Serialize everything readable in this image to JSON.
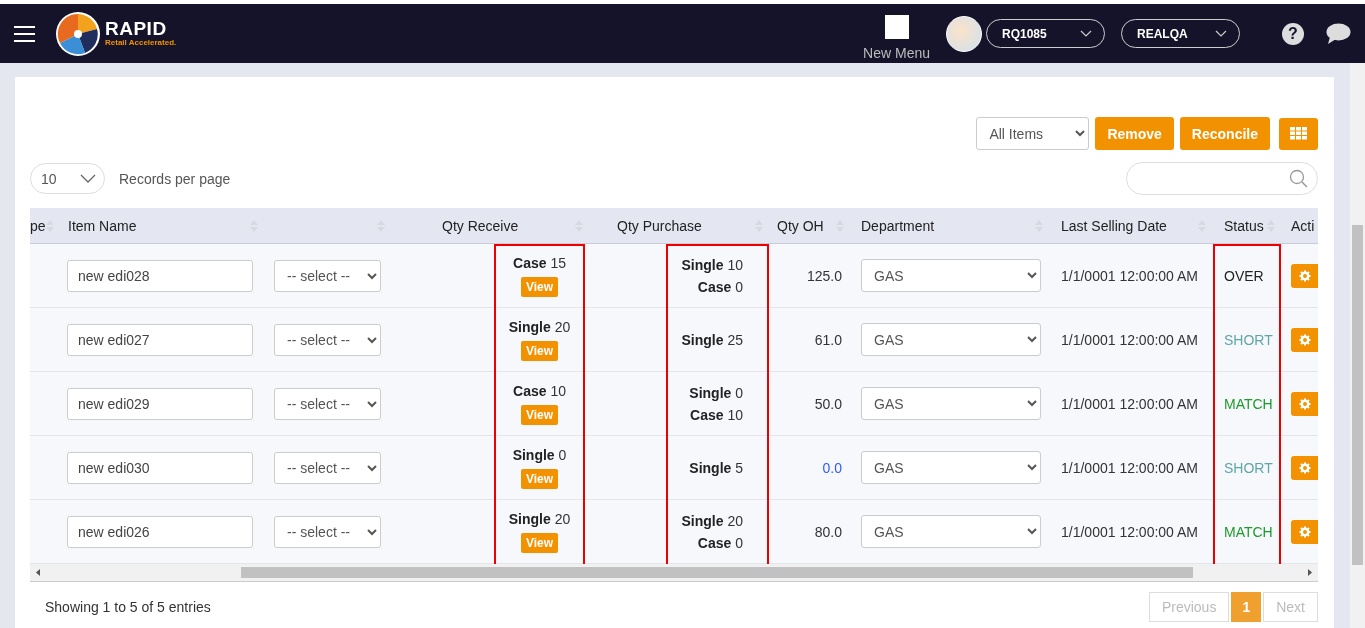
{
  "topbar": {
    "logo": {
      "name": "RAPID",
      "tagline": "Retail Accelerated."
    },
    "new_menu": "New Menu",
    "store_select": "RQ1085",
    "env_select": "REALQA",
    "help": "?"
  },
  "toolbar": {
    "filter": "All Items",
    "buttons": [
      "Remove",
      "Reconcile"
    ],
    "page_size": "10",
    "page_size_label": "Records per page"
  },
  "table": {
    "columns": [
      {
        "label": "pe",
        "kind": "clipped",
        "highlighted": false
      },
      {
        "label": "Item Name",
        "kind": "item_input",
        "highlighted": false
      },
      {
        "kind": "mapping_select",
        "highlighted": false
      },
      {
        "label": "Qty Receive",
        "kind": "qty_receive",
        "highlighted": true
      },
      {
        "label": "Qty Purchase",
        "kind": "qty_purchase",
        "highlighted": true
      },
      {
        "label": "Qty OH",
        "kind": "qty_oh",
        "highlighted": false
      },
      {
        "label": "Department",
        "kind": "department",
        "highlighted": false
      },
      {
        "label": "Last Selling Date",
        "kind": "date",
        "highlighted": false
      },
      {
        "label": "Status",
        "kind": "status",
        "highlighted": true
      },
      {
        "label": "Acti",
        "kind": "action",
        "highlighted": false
      }
    ],
    "rows": [
      {
        "item_name": "new edi028",
        "mapping": "-- select --",
        "receive": [
          {
            "unit": "Case",
            "qty": "15"
          }
        ],
        "view": "View",
        "purchase": [
          {
            "unit": "Single",
            "qty": "10"
          },
          {
            "unit": "Case",
            "qty": "0"
          }
        ],
        "qty_oh": {
          "text": "125.0",
          "color": "#333333"
        },
        "department": "GAS",
        "last_selling": "1/1/0001 12:00:00 AM",
        "status": {
          "text": "OVER",
          "color": "#222222"
        }
      },
      {
        "item_name": "new edi027",
        "mapping": "-- select --",
        "receive": [
          {
            "unit": "Single",
            "qty": "20"
          }
        ],
        "view": "View",
        "purchase": [
          {
            "unit": "Single",
            "qty": "25"
          }
        ],
        "qty_oh": {
          "text": "61.0",
          "color": "#333333"
        },
        "department": "GAS",
        "last_selling": "1/1/0001 12:00:00 AM",
        "status": {
          "text": "SHORT",
          "color": "#5ea5a5"
        }
      },
      {
        "item_name": "new edi029",
        "mapping": "-- select --",
        "receive": [
          {
            "unit": "Case",
            "qty": "10"
          }
        ],
        "view": "View",
        "purchase": [
          {
            "unit": "Single",
            "qty": "0"
          },
          {
            "unit": "Case",
            "qty": "10"
          }
        ],
        "qty_oh": {
          "text": "50.0",
          "color": "#333333"
        },
        "department": "GAS",
        "last_selling": "1/1/0001 12:00:00 AM",
        "status": {
          "text": "MATCH",
          "color": "#1e9a2e"
        }
      },
      {
        "item_name": "new edi030",
        "mapping": "-- select --",
        "receive": [
          {
            "unit": "Single",
            "qty": "0"
          }
        ],
        "view": "View",
        "purchase": [
          {
            "unit": "Single",
            "qty": "5"
          }
        ],
        "qty_oh": {
          "text": "0.0",
          "color": "#2d5bff"
        },
        "department": "GAS",
        "last_selling": "1/1/0001 12:00:00 AM",
        "status": {
          "text": "SHORT",
          "color": "#5ea5a5"
        }
      },
      {
        "item_name": "new edi026",
        "mapping": "-- select --",
        "receive": [
          {
            "unit": "Single",
            "qty": "20"
          }
        ],
        "view": "View",
        "purchase": [
          {
            "unit": "Single",
            "qty": "20"
          },
          {
            "unit": "Case",
            "qty": "0"
          }
        ],
        "qty_oh": {
          "text": "80.0",
          "color": "#333333"
        },
        "department": "GAS",
        "last_selling": "1/1/0001 12:00:00 AM",
        "status": {
          "text": "MATCH",
          "color": "#1e9a2e"
        }
      }
    ]
  },
  "footer": {
    "summary": "Showing 1 to 5 of 5 entries",
    "pagination": [
      {
        "label": "Previous",
        "selected": false,
        "disabled": true
      },
      {
        "label": "1",
        "selected": true,
        "disabled": false
      },
      {
        "label": "Next",
        "selected": false,
        "disabled": true
      }
    ]
  }
}
